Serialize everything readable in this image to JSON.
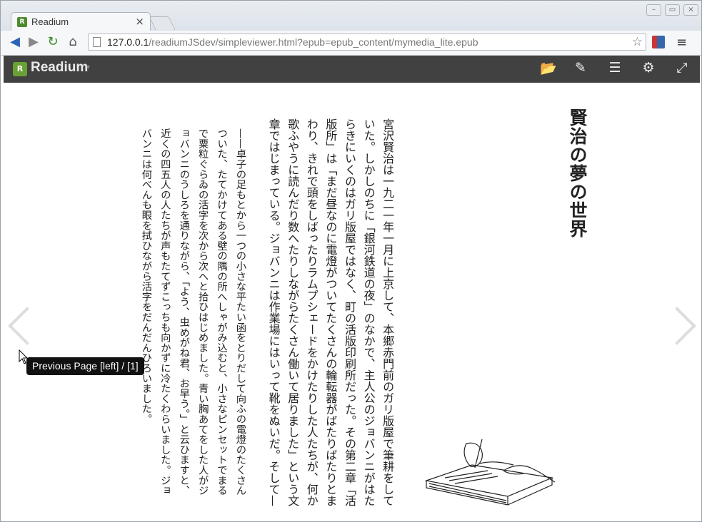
{
  "browser": {
    "tab_title": "Readium",
    "url_host": "127.0.0.1",
    "url_path": "/readiumJSdev/simpleviewer.html?epub=epub_content/mymedia_lite.epub"
  },
  "readium": {
    "brand": "Readium"
  },
  "book": {
    "heading": "賢治の夢の世界",
    "paragraph1": "宮沢賢治は一九二一年一月に上京して、本郷赤門前のガリ版屋で筆耕をしていた。しかしのちに「銀河鉄道の夜」のなかで、主人公のジョバンニがはたらきにいくのはガリ版屋ではなく、町の活版印刷所だった。その第二章「活版所」は「まだ昼なのに電燈がついてたくさんの輪転器がばたりばたりとまわり、きれで頭をしばったりラムプシェードをかけたりした人たちが、何か歌ふやうに読んだり数へたりしながらたくさん働いて居りました」という文章ではじまっている。ジョバンニは作業場にはいって靴をぬいだ。そして—",
    "paragraph2": "——卓子の足もとから一つの小さな平たい函をとりだして向ふの電燈のたくさんついた、たてかけてある壁の隅の所へしゃがみ込むと、小さなピンセットでまるで粟粒ぐらゐの活字を次から次へと拾ひはじめました。青い胸あてをした人がジョバンニのうしろを通りながら、「よう、虫めがね君、お早う。」と云ひますと、近くの四五人の人たちが声もたてずこっちも向かずに冷たくわらいました。ジョバンニは何べんも眼を拭ひながら活字をだんだんひろいました。"
  },
  "tooltip": "Previous Page [left] / [1]"
}
